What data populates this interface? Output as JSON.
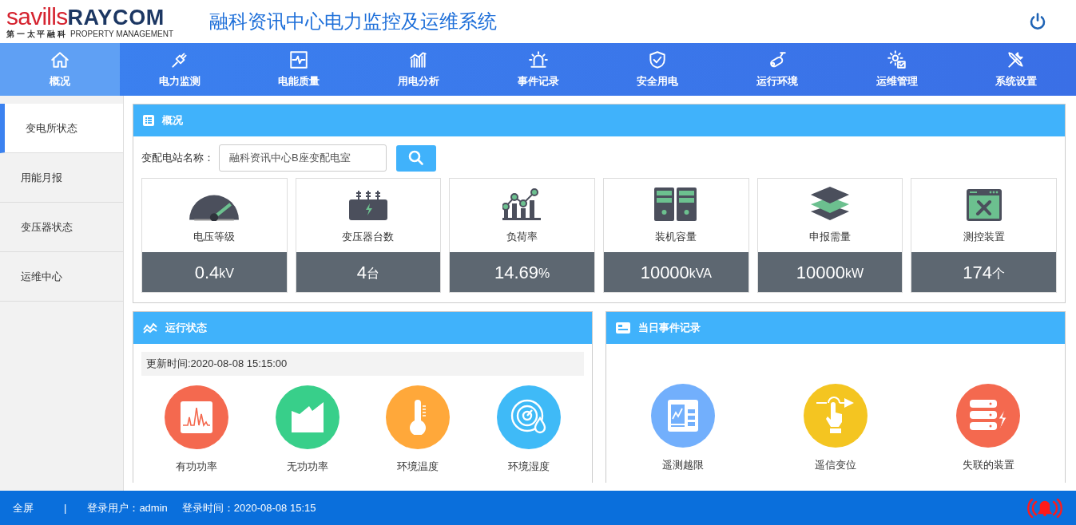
{
  "header": {
    "logo_brand": "savills",
    "logo_brand_2": "RAYCOM",
    "logo_sub_cn": "第 一 太 平 融 科",
    "logo_sub_en": "PROPERTY MANAGEMENT",
    "title": "融科资讯中心电力监控及运维系统"
  },
  "nav": [
    {
      "label": "概况",
      "selected": true
    },
    {
      "label": "电力监测",
      "selected": false
    },
    {
      "label": "电能质量",
      "selected": false
    },
    {
      "label": "用电分析",
      "selected": false
    },
    {
      "label": "事件记录",
      "selected": false
    },
    {
      "label": "安全用电",
      "selected": false
    },
    {
      "label": "运行环境",
      "selected": false
    },
    {
      "label": "运维管理",
      "selected": false
    },
    {
      "label": "系统设置",
      "selected": false
    }
  ],
  "sidebar": {
    "items": [
      {
        "label": "变电所状态",
        "selected": true
      },
      {
        "label": "用能月报",
        "selected": false
      },
      {
        "label": "变压器状态",
        "selected": false
      },
      {
        "label": "运维中心",
        "selected": false
      }
    ]
  },
  "overview": {
    "title": "概况",
    "station_label": "变配电站名称：",
    "station_value": "融科资讯中心B座变配电室",
    "cards": [
      {
        "label": "电压等级",
        "value": "0.4",
        "unit": "kV"
      },
      {
        "label": "变压器台数",
        "value": "4",
        "unit": "台"
      },
      {
        "label": "负荷率",
        "value": "14.69",
        "unit": "%"
      },
      {
        "label": "装机容量",
        "value": "10000",
        "unit": "kVA"
      },
      {
        "label": "申报需量",
        "value": "10000",
        "unit": "kW"
      },
      {
        "label": "测控装置",
        "value": "174",
        "unit": "个"
      }
    ]
  },
  "status_panel": {
    "title": "运行状态",
    "update_time": "更新时间:2020-08-08 15:15:00",
    "metrics": [
      {
        "label": "有功功率",
        "color": "#f4694f"
      },
      {
        "label": "无功功率",
        "color": "#38cf8a"
      },
      {
        "label": "环境温度",
        "color": "#ffa83a"
      },
      {
        "label": "环境湿度",
        "color": "#3fbaf7"
      }
    ]
  },
  "events_panel": {
    "title": "当日事件记录",
    "items": [
      {
        "label": "遥测越限",
        "color": "#72affc"
      },
      {
        "label": "遥信变位",
        "color": "#f4c521"
      },
      {
        "label": "失联的装置",
        "color": "#f4694f"
      }
    ]
  },
  "status_bar": {
    "fullscreen": "全屏",
    "separator": "|",
    "user": "登录用户：admin",
    "login_time": "登录时间：2020-08-08 15:15"
  }
}
